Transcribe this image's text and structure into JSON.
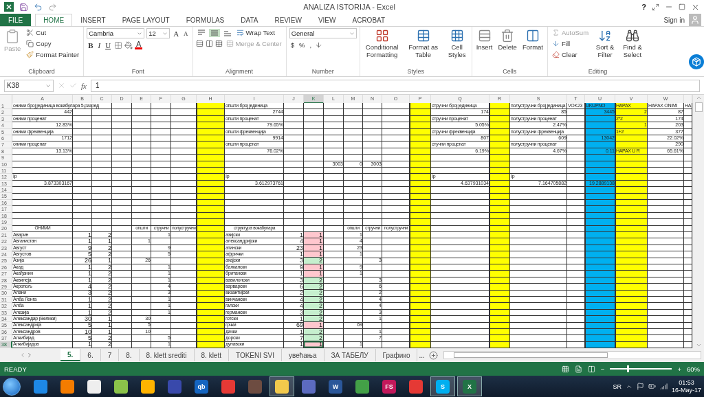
{
  "title_bar": {
    "title": "ANALIZA ISTORIJA - Excel",
    "help": "?"
  },
  "menu_tabs": [
    {
      "label": "FILE",
      "kind": "file",
      "selected": false
    },
    {
      "label": "HOME",
      "kind": "tab",
      "selected": true
    },
    {
      "label": "INSERT",
      "kind": "tab",
      "selected": false
    },
    {
      "label": "PAGE LAYOUT",
      "kind": "tab",
      "selected": false
    },
    {
      "label": "FORMULAS",
      "kind": "tab",
      "selected": false
    },
    {
      "label": "DATA",
      "kind": "tab",
      "selected": false
    },
    {
      "label": "REVIEW",
      "kind": "tab",
      "selected": false
    },
    {
      "label": "VIEW",
      "kind": "tab",
      "selected": false
    },
    {
      "label": "ACROBAT",
      "kind": "tab",
      "selected": false
    }
  ],
  "sign_in": "Sign in",
  "ribbon": {
    "clipboard": {
      "label": "Clipboard",
      "paste": {
        "label": "Paste",
        "disabled": true
      },
      "cut": "Cut",
      "copy": "Copy",
      "format_painter": "Format Painter"
    },
    "font": {
      "label": "Font",
      "name": "Cambria",
      "size": "12",
      "grow": "A",
      "shrink": "A",
      "bold": "B",
      "italic": "I",
      "underline": "U",
      "font_color_button": "A"
    },
    "alignment": {
      "label": "Alignment",
      "vertical": [
        {
          "selected": false
        },
        {
          "selected": true
        },
        {
          "selected": false
        }
      ],
      "wrap": "Wrap Text",
      "merge": {
        "label": "Merge & Center",
        "disabled": true
      }
    },
    "number": {
      "label": "Number",
      "format": "General",
      "currency": "$",
      "percent": "%",
      "comma": ","
    },
    "styles": {
      "label": "Styles",
      "conditional": "Conditional Formatting",
      "table": "Format as Table",
      "cell_styles": "Cell Styles"
    },
    "cells": {
      "label": "Cells",
      "insert": "Insert",
      "delete": "Delete",
      "format": "Format"
    },
    "editing": {
      "label": "Editing",
      "autosum": {
        "label": "AutoSum",
        "disabled": true
      },
      "fill": "Fill",
      "clear": "Clear",
      "sort": "Sort & Filter",
      "find": "Find & Select"
    }
  },
  "formula_bar": {
    "name_box": "K38",
    "fx": "fx",
    "value": "1"
  },
  "sheet": {
    "columns": {
      "A": {
        "header": "A",
        "selected": false
      },
      "B": {
        "header": "B",
        "selected": false
      },
      "C": {
        "header": "C",
        "selected": false
      },
      "D": {
        "header": "D",
        "selected": false
      },
      "E": {
        "header": "E",
        "selected": false
      },
      "F": {
        "header": "F",
        "selected": false
      },
      "G": {
        "header": "G",
        "selected": false
      },
      "H": {
        "header": "H",
        "selected": false,
        "color": "#ffff00"
      },
      "I": {
        "header": "I",
        "selected": false
      },
      "J": {
        "header": "J",
        "selected": false
      },
      "K": {
        "header": "K",
        "selected": true
      },
      "L": {
        "header": "L",
        "selected": false
      },
      "M": {
        "header": "M",
        "selected": false
      },
      "N": {
        "header": "N",
        "selected": false
      },
      "O": {
        "header": "O",
        "selected": false
      },
      "P": {
        "header": "P",
        "selected": false,
        "color": "#ffff00"
      },
      "Q": {
        "header": "Q",
        "selected": false
      },
      "R": {
        "header": "R",
        "selected": false,
        "color": "#ffff00"
      },
      "S": {
        "header": "S",
        "selected": false
      },
      "T": {
        "header": "T",
        "selected": false
      },
      "U": {
        "header": "U",
        "selected": false,
        "color": "#00b0f0"
      },
      "V": {
        "header": "V",
        "selected": false,
        "color": "#ffff00"
      },
      "W": {
        "header": "W",
        "selected": false
      },
      "X": {
        "selected": false
      }
    },
    "rows": [
      {
        "number": "1",
        "selected": false,
        "cells": {
          "A": {
            "text": "оними број јединица вокабулара 5.разред",
            "kind": "label"
          },
          "I": {
            "text": "општи број јединица",
            "kind": "label"
          },
          "Q": {
            "text": "стручни број јединица",
            "kind": "label"
          },
          "S": {
            "text": "полустручни број јединица",
            "kind": "label"
          },
          "T": {
            "text": "VOK23",
            "kind": "label"
          },
          "U": {
            "text": "UKUPNO",
            "kind": "label"
          },
          "V": {
            "text": "HAPAX",
            "kind": "label"
          },
          "W": {
            "text": "HAPAX ONIMI",
            "kind": "label"
          },
          "X": {
            "text": "HA",
            "kind": "label"
          }
        }
      },
      {
        "number": "2",
        "selected": false,
        "cells": {
          "A": "442",
          "I": "2744",
          "Q": "174",
          "S": "85",
          "U": "3445",
          "V": "2",
          "W": "87"
        }
      },
      {
        "number": "3",
        "selected": false,
        "cells": {
          "A": {
            "text": "оними проценат",
            "kind": "label"
          },
          "I": {
            "text": "општи проценат",
            "kind": "label"
          },
          "Q": {
            "text": "стручни  проценат",
            "kind": "label"
          },
          "S": {
            "text": "полустручни проценат",
            "kind": "label"
          },
          "V": {
            "text": "2*2",
            "kind": "label"
          },
          "W": "174"
        }
      },
      {
        "number": "4",
        "selected": false,
        "cells": {
          "A": "12.83%",
          "I": "79.65%",
          "Q": "5.05%",
          "S": "2.47%",
          "V": "1",
          "W": "203"
        }
      },
      {
        "number": "5",
        "selected": false,
        "cells": {
          "A": {
            "text": "оними фреквенција",
            "kind": "label"
          },
          "I": {
            "text": "општи фреквенција",
            "kind": "label"
          },
          "Q": {
            "text": "стручни  фреквенција",
            "kind": "label"
          },
          "S": {
            "text": "полустручни фреквенција",
            "kind": "label"
          },
          "V": {
            "text": "1+2",
            "kind": "label"
          },
          "W": "377"
        }
      },
      {
        "number": "6",
        "selected": false,
        "cells": {
          "A": "1712",
          "I": "9914",
          "Q": "807",
          "S": "609",
          "U": "13042",
          "W": "22.02%"
        }
      },
      {
        "number": "7",
        "selected": false,
        "cells": {
          "A": {
            "text": "оними проценат",
            "kind": "label"
          },
          "I": {
            "text": "општи проценат",
            "kind": "label"
          },
          "Q": {
            "text": "стучни  проценат",
            "kind": "label"
          },
          "S": {
            "text": "полустручни проценат",
            "kind": "label"
          },
          "W": "290"
        }
      },
      {
        "number": "8",
        "selected": false,
        "cells": {
          "A": "13.13%",
          "I": "76.02%",
          "Q": "6.19%",
          "S": "4.67%",
          "U": "0.11",
          "V": {
            "text": "HAPAX U R",
            "kind": "label"
          },
          "W": "65.61%"
        }
      },
      {
        "number": "9",
        "selected": false
      },
      {
        "number": "10",
        "selected": false,
        "cells": {
          "L": "3003",
          "M": "0",
          "N": "3003"
        }
      },
      {
        "number": "11",
        "selected": false
      },
      {
        "number": "12",
        "selected": false,
        "cells": {
          "A": {
            "text": "Ip",
            "kind": "label"
          },
          "I": {
            "text": "Ip",
            "kind": "label"
          },
          "Q": {
            "text": "Ip",
            "kind": "label"
          },
          "S": {
            "text": "Ip",
            "kind": "label"
          }
        }
      },
      {
        "number": "13",
        "selected": false,
        "cells": {
          "A": "3.873303167",
          "I": "3.612973761",
          "Q": "4.637931034",
          "S": "7.164705882",
          "U": "19.2889138"
        }
      },
      {
        "number": "14",
        "selected": false
      },
      {
        "number": "15",
        "selected": false
      },
      {
        "number": "16",
        "selected": false
      },
      {
        "number": "17",
        "selected": false
      },
      {
        "number": "18",
        "selected": false
      },
      {
        "number": "19",
        "selected": false
      },
      {
        "number": "20",
        "selected": false,
        "cells": {
          "A": {
            "text": "ОНИМИ",
            "kind": "heading"
          },
          "E": {
            "text": "општи",
            "kind": "heading"
          },
          "F": {
            "text": "стручни",
            "kind": "heading"
          },
          "G": {
            "text": "полустручни",
            "kind": "heading"
          },
          "I": {
            "text": "структура вокабулара",
            "kind": "heading"
          },
          "M": {
            "text": "општи",
            "kind": "heading"
          },
          "N": {
            "text": "стручни",
            "kind": "heading"
          },
          "O": {
            "text": "полустручни",
            "kind": "heading"
          }
        }
      },
      {
        "number": "21",
        "selected": false,
        "cells": {
          "A": {
            "text": "Аварин",
            "kind": "label"
          },
          "B": "1",
          "C": "2",
          "F": "1",
          "I": {
            "text": "азијски",
            "kind": "label"
          },
          "J": "1",
          "K": {
            "text": "1",
            "color": "#ffc7ce"
          },
          "M": "1"
        }
      },
      {
        "number": "22",
        "selected": false,
        "cells": {
          "A": {
            "text": "Авганистан",
            "kind": "label"
          },
          "B": "1",
          "C": "1",
          "E": "1",
          "I": {
            "text": "александријски",
            "kind": "label"
          },
          "J": "4",
          "K": {
            "text": "1",
            "color": "#ffc7ce"
          },
          "M": "4"
        }
      },
      {
        "number": "23",
        "selected": false,
        "cells": {
          "A": {
            "text": "Август",
            "kind": "label"
          },
          "B": "9",
          "C": "2",
          "F": "9",
          "I": {
            "text": "атински",
            "kind": "label"
          },
          "J": "23",
          "K": {
            "text": "1",
            "color": "#ffc7ce"
          },
          "M": "23"
        }
      },
      {
        "number": "24",
        "selected": false,
        "cells": {
          "A": {
            "text": "Августов",
            "kind": "label"
          },
          "B": "5",
          "C": "2",
          "F": "5",
          "I": {
            "text": "афрички",
            "kind": "label"
          },
          "J": "1",
          "K": {
            "text": "1",
            "color": "#ffc7ce"
          },
          "M": "1"
        }
      },
      {
        "number": "25",
        "selected": false,
        "cells": {
          "A": {
            "text": "Азија",
            "kind": "label"
          },
          "B": "26",
          "C": "1",
          "E": "26",
          "I": {
            "text": "ахајски",
            "kind": "label"
          },
          "J": "3",
          "K": {
            "text": "2",
            "color": "#c6efce"
          },
          "N": "3"
        }
      },
      {
        "number": "26",
        "selected": false,
        "cells": {
          "A": {
            "text": "Акад",
            "kind": "label"
          },
          "B": "1",
          "C": "2",
          "F": "1",
          "I": {
            "text": "балкански",
            "kind": "label"
          },
          "J": "9",
          "K": {
            "text": "1",
            "color": "#ffc7ce"
          },
          "M": "9"
        }
      },
      {
        "number": "27",
        "selected": false,
        "cells": {
          "A": {
            "text": "Акађанин",
            "kind": "label"
          },
          "B": "1",
          "C": "2",
          "F": "1",
          "I": {
            "text": "британски",
            "kind": "label"
          },
          "J": "1",
          "K": {
            "text": "1",
            "color": "#ffc7ce"
          },
          "M": "1"
        }
      },
      {
        "number": "28",
        "selected": false,
        "cells": {
          "A": {
            "text": "Аквилеја",
            "kind": "label"
          },
          "B": "1",
          "C": "2",
          "F": "1",
          "I": {
            "text": "вавилонски",
            "kind": "label"
          },
          "J": "3",
          "K": {
            "text": "2",
            "color": "#c6efce"
          },
          "N": "3"
        }
      },
      {
        "number": "29",
        "selected": false,
        "cells": {
          "A": {
            "text": "Акропољ",
            "kind": "label"
          },
          "B": "4",
          "C": "2",
          "F": "4",
          "I": {
            "text": "варварски",
            "kind": "label"
          },
          "J": "6",
          "K": {
            "text": "2",
            "color": "#c6efce"
          },
          "N": "6"
        }
      },
      {
        "number": "30",
        "selected": false,
        "cells": {
          "A": {
            "text": "Алани",
            "kind": "label"
          },
          "B": "3",
          "C": "2",
          "F": "3",
          "I": {
            "text": "византијски",
            "kind": "label"
          },
          "J": "2",
          "K": {
            "text": "2",
            "color": "#c6efce"
          },
          "N": "2"
        }
      },
      {
        "number": "31",
        "selected": false,
        "cells": {
          "A": {
            "text": "Алба Лонга",
            "kind": "label"
          },
          "B": "1",
          "C": "2",
          "F": "1",
          "I": {
            "text": "винчански",
            "kind": "label"
          },
          "J": "4",
          "K": {
            "text": "2",
            "color": "#c6efce"
          },
          "N": "4"
        }
      },
      {
        "number": "32",
        "selected": false,
        "cells": {
          "A": {
            "text": "Алба",
            "kind": "label"
          },
          "B": "1",
          "C": "2",
          "F": "1",
          "I": {
            "text": "галски",
            "kind": "label"
          },
          "J": "4",
          "K": {
            "text": "2",
            "color": "#c6efce"
          },
          "N": "4"
        }
      },
      {
        "number": "33",
        "selected": false,
        "cells": {
          "A": {
            "text": "Алезија",
            "kind": "label"
          },
          "B": "1",
          "C": "2",
          "F": "1",
          "I": {
            "text": "германски",
            "kind": "label"
          },
          "J": "3",
          "K": {
            "text": "2",
            "color": "#c6efce"
          },
          "N": "3"
        }
      },
      {
        "number": "34",
        "selected": false,
        "cells": {
          "A": {
            "text": "Александар (Велики)",
            "kind": "label"
          },
          "B": "30",
          "C": "1",
          "E": "30",
          "I": {
            "text": "готски",
            "kind": "label"
          },
          "J": "1",
          "K": {
            "text": "2",
            "color": "#c6efce"
          },
          "N": "1"
        }
      },
      {
        "number": "35",
        "selected": false,
        "cells": {
          "A": {
            "text": "Александрија",
            "kind": "label"
          },
          "B": "5",
          "C": "1",
          "E": "5",
          "I": {
            "text": "грчки",
            "kind": "label"
          },
          "J": "69",
          "K": {
            "text": "1",
            "color": "#ffc7ce"
          },
          "M": "69"
        }
      },
      {
        "number": "36",
        "selected": false,
        "cells": {
          "A": {
            "text": "Александров",
            "kind": "label"
          },
          "B": "10",
          "C": "1",
          "E": "10",
          "I": {
            "text": "дачки",
            "kind": "label"
          },
          "J": "1",
          "K": {
            "text": "2",
            "color": "#c6efce"
          },
          "N": "1"
        }
      },
      {
        "number": "37",
        "selected": false,
        "cells": {
          "A": {
            "text": "Алкибијад",
            "kind": "label"
          },
          "B": "5",
          "C": "2",
          "F": "5",
          "I": {
            "text": "дорски",
            "kind": "label"
          },
          "J": "7",
          "K": {
            "text": "2",
            "color": "#c6efce"
          },
          "N": "7"
        }
      },
      {
        "number": "38",
        "selected": true,
        "cells": {
          "A": {
            "text": "Алкибијадов",
            "kind": "label"
          },
          "B": "1",
          "C": "2",
          "F": "1",
          "I": {
            "text": "дунавски",
            "kind": "label"
          },
          "J": "1",
          "K": {
            "text": "1",
            "color": "#ffc7ce"
          },
          "M": "1"
        }
      }
    ]
  },
  "sheet_tabs": [
    {
      "label": "5.",
      "selected": true
    },
    {
      "label": "6.",
      "selected": false
    },
    {
      "label": "7",
      "selected": false
    },
    {
      "label": "8.",
      "selected": false
    },
    {
      "label": "8. klett srediti",
      "selected": false
    },
    {
      "label": "8. klett",
      "selected": false
    },
    {
      "label": "TOKENI SVI",
      "selected": false
    },
    {
      "label": "увећања",
      "selected": false
    },
    {
      "label": "ЗА ТАБЕЛУ",
      "selected": false
    },
    {
      "label": "Графико",
      "selected": false
    }
  ],
  "sheet_tabs_more": "...",
  "status_bar": {
    "status": "READY",
    "zoom_out": "−",
    "zoom_in": "+",
    "zoom": "60%",
    "zoom_level": {
      "level": 0.27
    }
  },
  "taskbar": {
    "apps": [
      {
        "color": "#1e88e5",
        "active": false
      },
      {
        "color": "#f57c00",
        "active": false
      },
      {
        "color": "#eeeeee",
        "active": false
      },
      {
        "color": "#8bc34a",
        "active": false
      },
      {
        "color": "#ffb300",
        "active": false
      },
      {
        "color": "#3949ab",
        "active": false
      },
      {
        "color": "#1565c0",
        "label": "qb",
        "active": false
      },
      {
        "color": "#e53935",
        "active": false
      },
      {
        "color": "#6d4c41",
        "active": false
      },
      {
        "color": "#f2c94c",
        "active": true
      },
      {
        "color": "#5c6bc0",
        "active": false
      },
      {
        "color": "#2b579a",
        "label": "W",
        "active": false
      },
      {
        "color": "#43a047",
        "active": false
      },
      {
        "color": "#c2185b",
        "label": "FS",
        "active": false
      },
      {
        "color": "#e53935",
        "active": false
      },
      {
        "color": "#00aff0",
        "label": "S",
        "active": true
      },
      {
        "color": "#217346",
        "label": "X",
        "active": true
      }
    ],
    "language": "SR",
    "time": "01:53",
    "date": "16-May-17"
  }
}
